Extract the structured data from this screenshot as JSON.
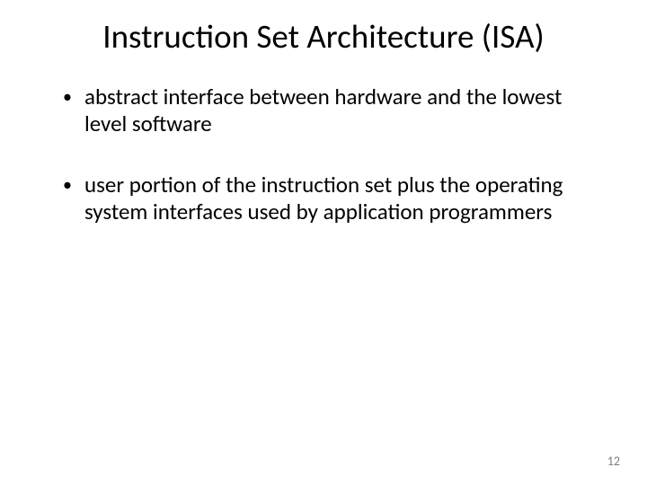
{
  "slide": {
    "title": "Instruction Set Architecture (ISA)",
    "bullets": [
      "abstract interface between hardware and the lowest level software",
      "user portion of the instruction set plus the operating system interfaces used by application programmers"
    ],
    "page_number": "12"
  }
}
